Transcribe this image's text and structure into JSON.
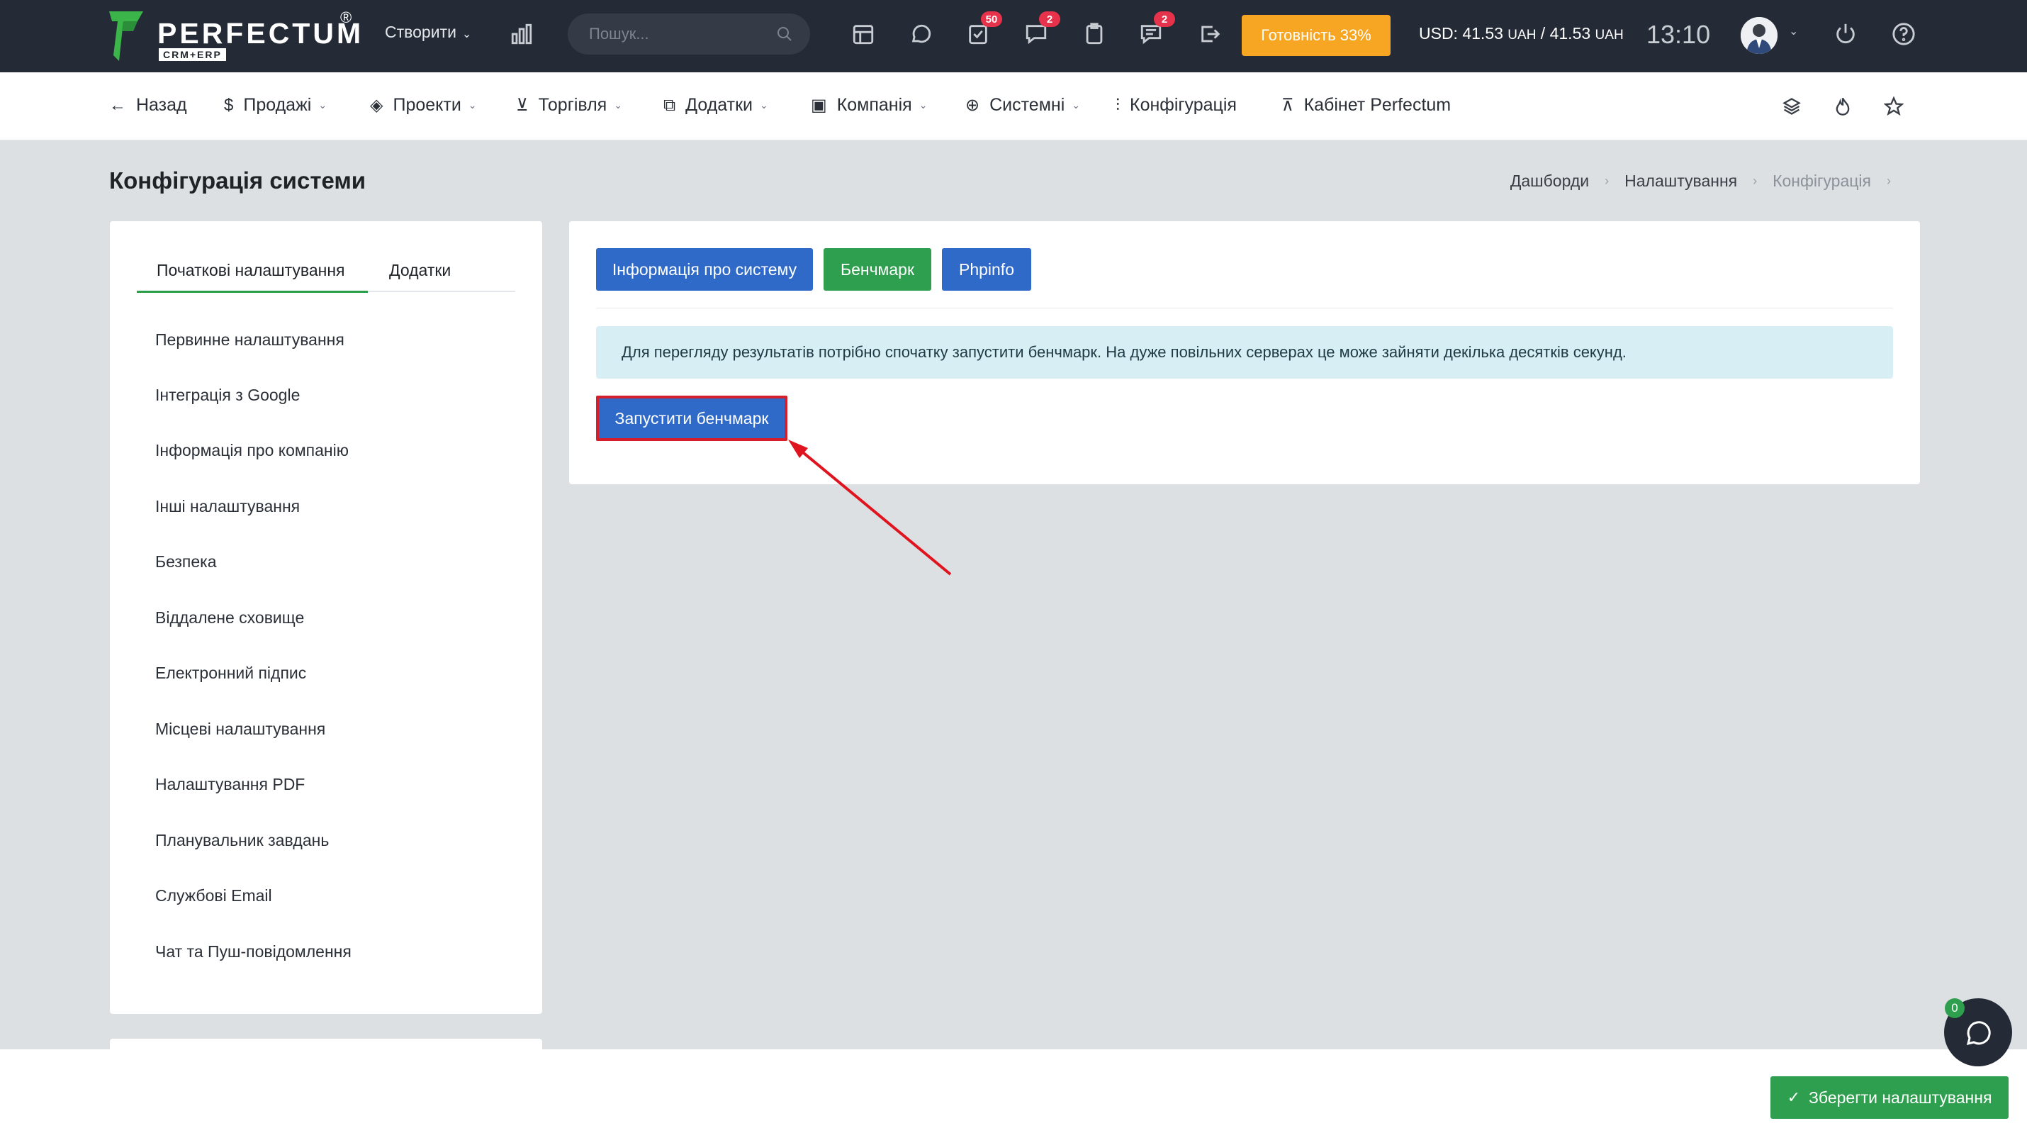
{
  "topbar": {
    "logo_text": "PERFECTUM",
    "logo_sub": "CRM+ERP",
    "logo_reg": "®",
    "create_label": "Створити",
    "search_placeholder": "Пошук...",
    "badges": {
      "tasks": "50",
      "messages": "2",
      "chat": "2"
    },
    "readiness_label": "Готовність 33%",
    "rates_prefix": "USD: 41.53",
    "rates_unit1": "UAH",
    "rates_sep": " / 41.53",
    "rates_unit2": "UAH",
    "clock": "13:10"
  },
  "navbar": {
    "back": "Назад",
    "sales": "Продажі",
    "projects": "Проекти",
    "trade": "Торгівля",
    "addons": "Додатки",
    "company": "Компанія",
    "system": "Системні",
    "config": "Конфігурація",
    "cabinet": "Кабінет Perfectum"
  },
  "page": {
    "title": "Конфігурація системи",
    "breadcrumb": [
      "Дашборди",
      "Налаштування",
      "Конфігурація"
    ]
  },
  "sidebar": {
    "tabs": [
      "Початкові налаштування",
      "Додатки"
    ],
    "items": [
      "Первинне налаштування",
      "Інтеграція з Google",
      "Інформація про компанію",
      "Інші налаштування",
      "Безпека",
      "Віддалене сховище",
      "Електронний підпис",
      "Місцеві налаштування",
      "Налаштування PDF",
      "Планувальник завдань",
      "Службові Email",
      "Чат та Пуш-повідомлення"
    ]
  },
  "main": {
    "buttons": [
      "Інформація про систему",
      "Бенчмарк",
      "Phpinfo"
    ],
    "alert": "Для перегляду результатів потрібно спочатку запустити бенчмарк. На дуже повільних серверах це може зайняти декілька десятків секунд.",
    "run_button": "Запустити бенчмарк"
  },
  "footer": {
    "save_label": "Зберегти налаштування",
    "chat_count": "0"
  },
  "colors": {
    "topbar_bg": "#252b36",
    "primary_blue": "#2f6ac8",
    "success_green": "#2e9e4f",
    "warning_orange": "#f6a623",
    "highlight_red": "#d61f2c"
  }
}
